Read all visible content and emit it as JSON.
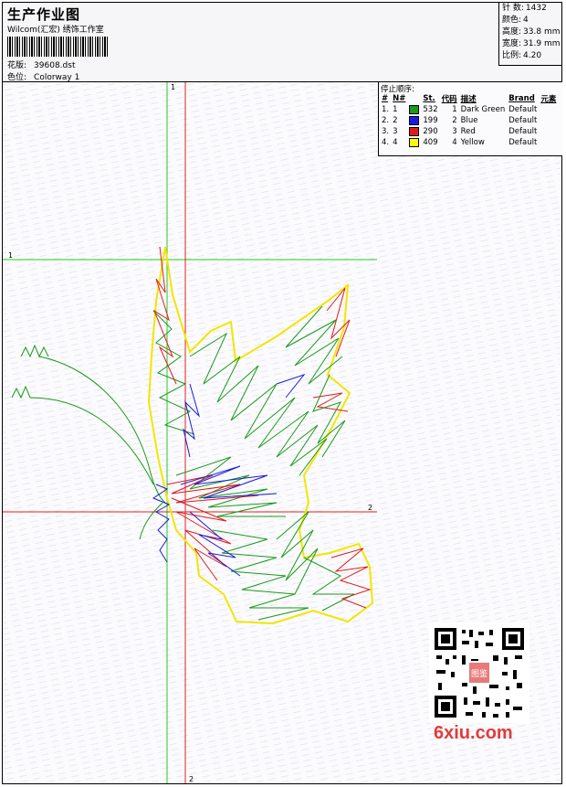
{
  "header": {
    "title": "生产作业图",
    "software": "Wilcom(汇宏) 绣饰工作室",
    "design_label": "花版:",
    "design_value": "39608.dst",
    "colorway_label": "色位:",
    "colorway_value": "Colorway 1"
  },
  "stats": {
    "stitches_label": "针 数:",
    "stitches_value": "1432",
    "colors_label": "颜色:",
    "colors_value": "4",
    "height_label": "高度:",
    "height_value": "33.8 mm",
    "width_label": "宽度:",
    "width_value": "31.9 mm",
    "ratio_label": "比例:",
    "ratio_value": "4.20"
  },
  "legend": {
    "title": "停止顺序:",
    "headers": [
      "#",
      "N#",
      "St.",
      "代码",
      "描述",
      "Brand",
      "元素"
    ],
    "rows": [
      {
        "idx": "1.",
        "n": "1",
        "color": "#1a9a1a",
        "st": "532",
        "code": "1",
        "desc": "Dark Green",
        "brand": "Default"
      },
      {
        "idx": "2.",
        "n": "2",
        "color": "#1a1ae0",
        "st": "199",
        "code": "2",
        "desc": "Blue",
        "brand": "Default"
      },
      {
        "idx": "3.",
        "n": "3",
        "color": "#e01a1a",
        "st": "290",
        "code": "3",
        "desc": "Red",
        "brand": "Default"
      },
      {
        "idx": "4.",
        "n": "4",
        "color": "#ffff00",
        "st": "409",
        "code": "4",
        "desc": "Yellow",
        "brand": "Default"
      }
    ]
  },
  "axes": {
    "green_v": "1",
    "green_h": "1",
    "red_h": "2",
    "red_v": "2"
  },
  "watermark": {
    "logo_text": "6xiu.com",
    "seal_text": "图鉴"
  }
}
